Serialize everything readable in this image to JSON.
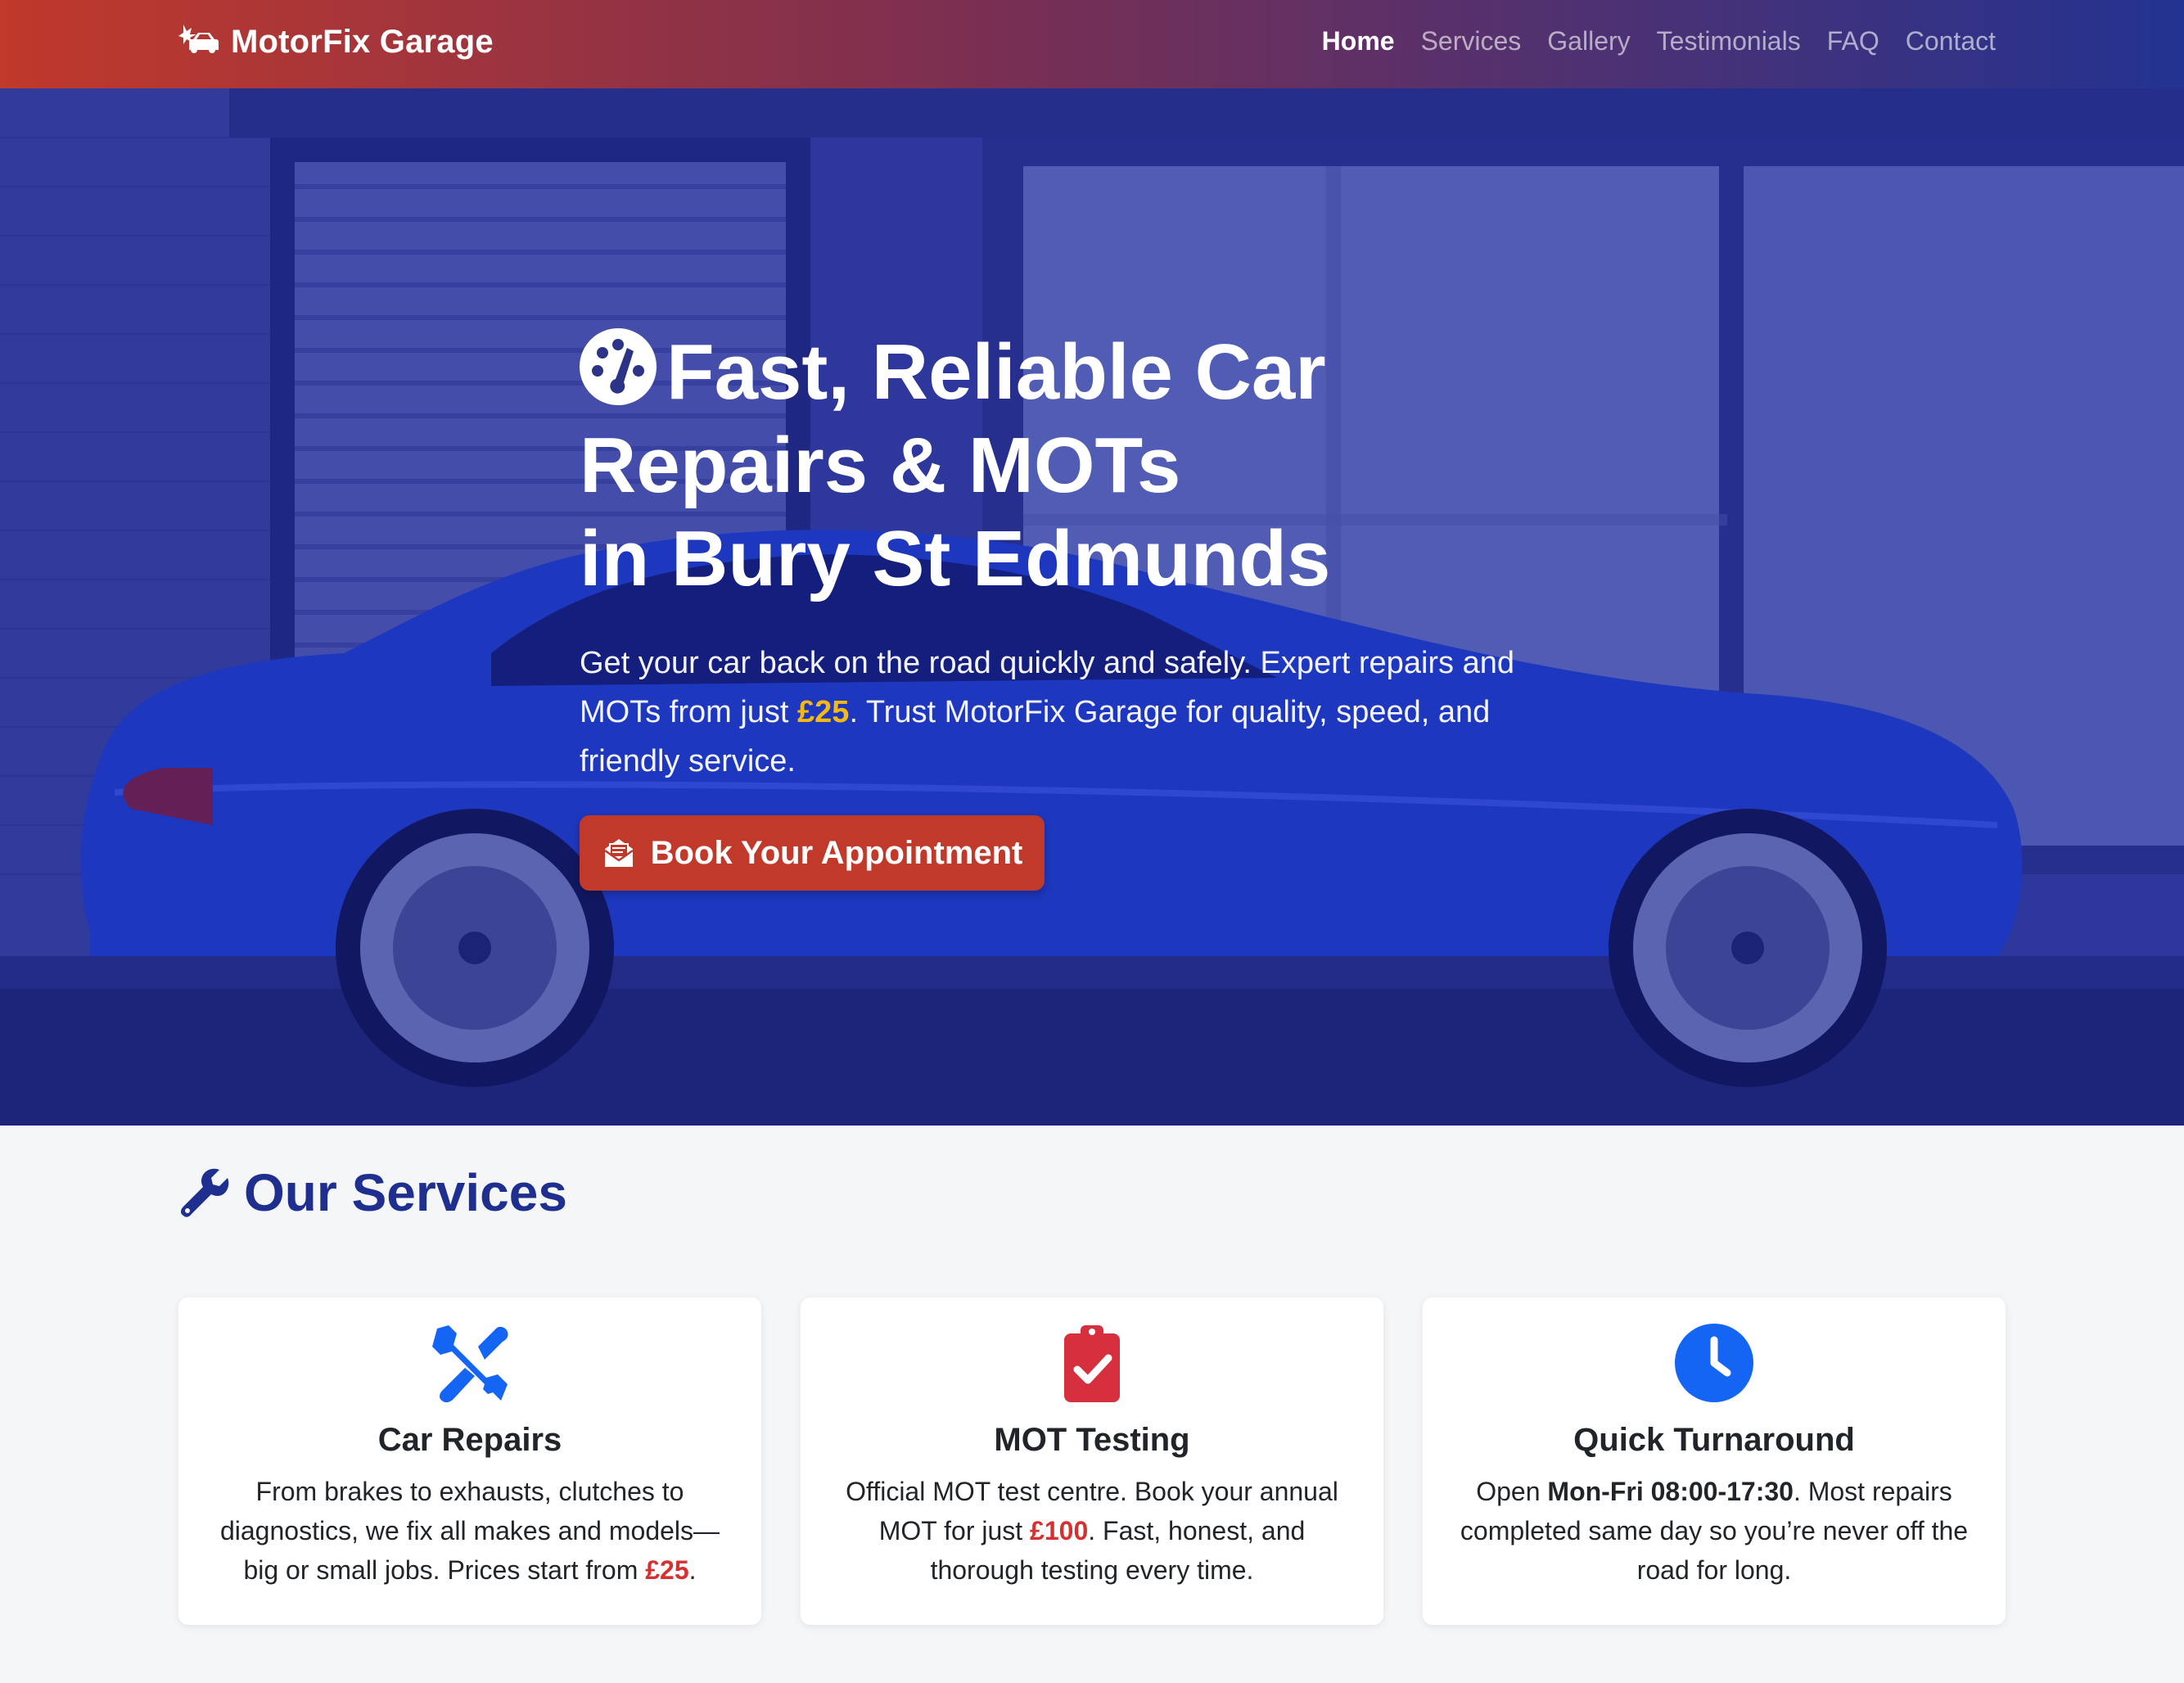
{
  "brand": {
    "name": "MotorFix Garage",
    "logo_icon": "car-crash-icon"
  },
  "nav": {
    "items": [
      {
        "label": "Home",
        "active": true
      },
      {
        "label": "Services",
        "active": false
      },
      {
        "label": "Gallery",
        "active": false
      },
      {
        "label": "Testimonials",
        "active": false
      },
      {
        "label": "FAQ",
        "active": false
      },
      {
        "label": "Contact",
        "active": false
      }
    ]
  },
  "hero": {
    "title_lines": [
      "Fast, Reliable Car",
      "Repairs & MOTs",
      "in Bury St Edmunds"
    ],
    "title_icon": "gauge-icon",
    "text_before": "Get your car back on the road quickly and safely. Expert repairs and MOTs from just ",
    "price": "£25",
    "text_after": ". Trust MotorFix Garage for quality, speed, and friendly service.",
    "cta_label": "Book Your Appointment",
    "cta_icon": "envelope-open-icon"
  },
  "services": {
    "heading": "Our Services",
    "heading_icon": "wrench-icon",
    "cards": [
      {
        "title": "Car Repairs",
        "icon": "tools-icon",
        "text_before": "From brakes to exhausts, clutches to diagnostics, we fix all makes and models—big or small jobs. Prices start from ",
        "highlight": "£25",
        "text_after": "."
      },
      {
        "title": "MOT Testing",
        "icon": "clipboard-check-icon",
        "text_before": "Official MOT test centre. Book your annual MOT for just ",
        "highlight": "£100",
        "text_after": ". Fast, honest, and thorough testing every time."
      },
      {
        "title": "Quick Turnaround",
        "icon": "clock-icon",
        "text_before": "Open ",
        "highlight": "Mon-Fri 08:00-17:30",
        "text_after": ". Most repairs completed same day so you’re never off the road for long."
      }
    ]
  },
  "colors": {
    "brand_red": "#c0392b",
    "brand_blue": "#1e2f8f",
    "price_yellow": "#f5b914",
    "highlight_red": "#d63031",
    "icon_blue": "#1565f5"
  }
}
